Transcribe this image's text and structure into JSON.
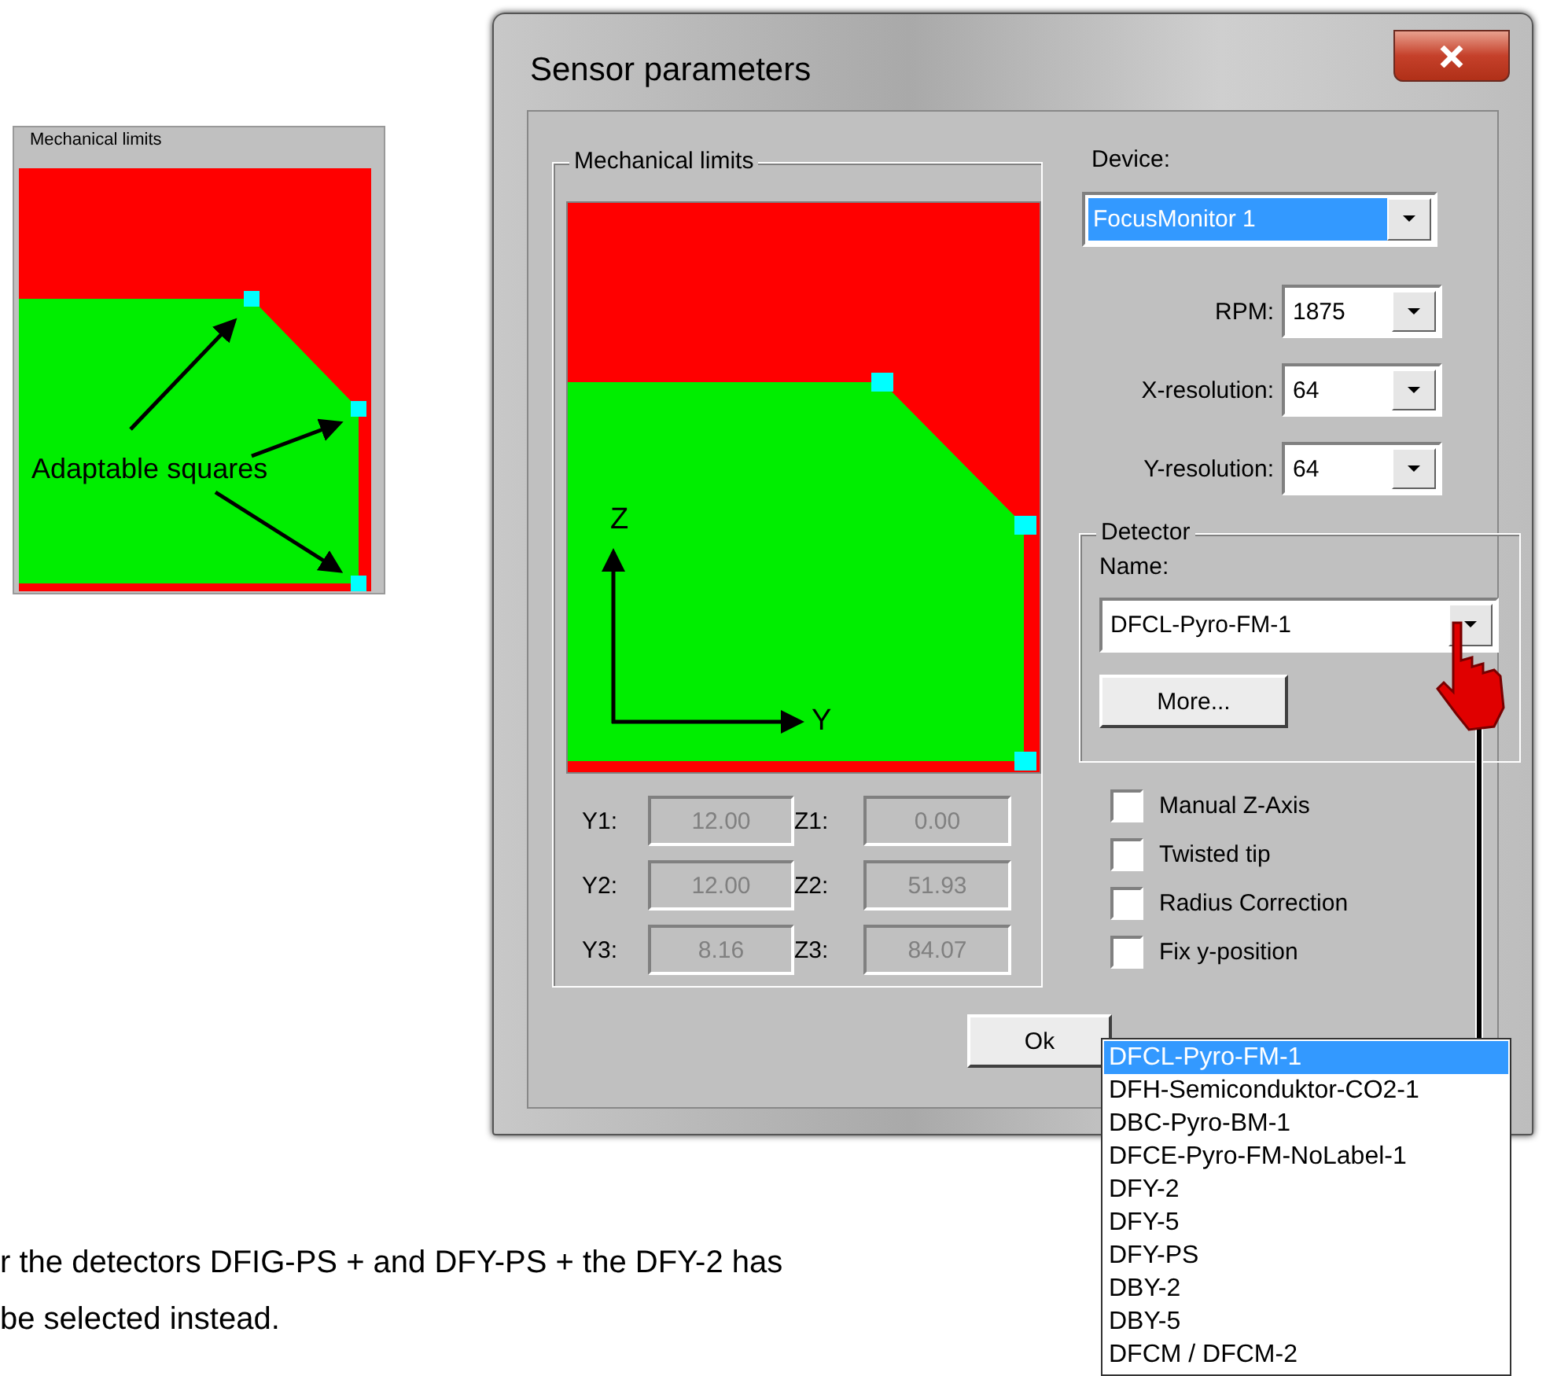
{
  "inset": {
    "legend": "Mechanical limits",
    "annotation": "Adaptable squares"
  },
  "dialog": {
    "title": "Sensor parameters",
    "limits": {
      "legend": "Mechanical limits",
      "axis_z": "Z",
      "axis_y": "Y",
      "fields": [
        {
          "label": "Y1:",
          "value": "12.00",
          "disabled": true
        },
        {
          "label": "Z1:",
          "value": "0.00",
          "disabled": true
        },
        {
          "label": "Y2:",
          "value": "12.00",
          "disabled": true
        },
        {
          "label": "Z2:",
          "value": "51.93",
          "disabled": true
        },
        {
          "label": "Y3:",
          "value": "8.16",
          "disabled": true
        },
        {
          "label": "Z3:",
          "value": "84.07",
          "disabled": true
        }
      ]
    },
    "device": {
      "label": "Device:",
      "value": "FocusMonitor 1",
      "highlighted": true
    },
    "settings": [
      {
        "label": "RPM:",
        "value": "1875"
      },
      {
        "label": "X-resolution:",
        "value": "64"
      },
      {
        "label": "Y-resolution:",
        "value": "64"
      }
    ],
    "detector": {
      "legend": "Detector",
      "name_label": "Name:",
      "value": "DFCL-Pyro-FM-1",
      "more_button": "More..."
    },
    "options": [
      {
        "label": "Manual Z-Axis",
        "checked": false
      },
      {
        "label": "Twisted tip",
        "checked": false
      },
      {
        "label": "Radius Correction",
        "checked": false
      },
      {
        "label": "Fix y-position",
        "checked": false
      }
    ],
    "ok_button": "Ok"
  },
  "dropdown": {
    "items": [
      {
        "label": "DFCL-Pyro-FM-1",
        "selected": true
      },
      {
        "label": "DFH-Semiconduktor-CO2-1",
        "selected": false
      },
      {
        "label": "DBC-Pyro-BM-1",
        "selected": false
      },
      {
        "label": "DFCE-Pyro-FM-NoLabel-1",
        "selected": false
      },
      {
        "label": "DFY-2",
        "selected": false
      },
      {
        "label": "DFY-5",
        "selected": false
      },
      {
        "label": "DFY-PS",
        "selected": false
      },
      {
        "label": "DBY-2",
        "selected": false
      },
      {
        "label": "DBY-5",
        "selected": false
      },
      {
        "label": "DFCM / DFCM-2",
        "selected": false
      }
    ]
  },
  "caption": [
    "r the detectors DFIG-PS + and DFY-PS + the DFY-2 has",
    "be selected instead."
  ]
}
